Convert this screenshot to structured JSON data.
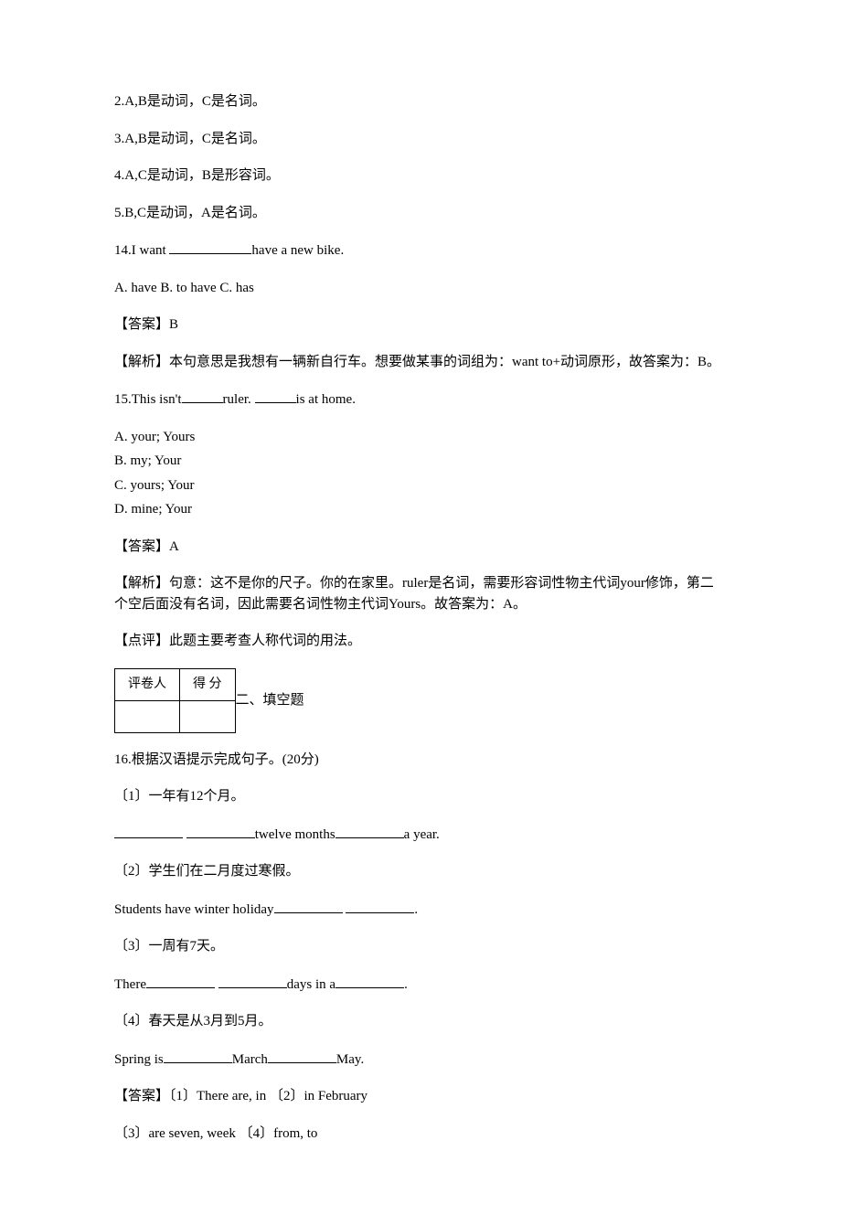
{
  "notes": {
    "n2": "2.A,B是动词，C是名词。",
    "n3": "3.A,B是动词，C是名词。",
    "n4": "4.A,C是动词，B是形容词。",
    "n5": "5.B,C是动词，A是名词。"
  },
  "q14": {
    "stem_pre": "14.I want ",
    "stem_post": "have a new bike.",
    "opts": "A. have   B. to have   C. has",
    "ans_label": "【答案】B",
    "explain": "【解析】本句意思是我想有一辆新自行车。想要做某事的词组为：want to+动词原形，故答案为：B。"
  },
  "q15": {
    "stem_pre": "15.This isn't",
    "stem_mid": "ruler. ",
    "stem_post": "is at home.",
    "optA": "A. your; Yours",
    "optB": "B. my; Your",
    "optC": "C. yours; Your",
    "optD": "D. mine; Your",
    "ans_label": "【答案】A",
    "explain": "【解析】句意：这不是你的尺子。你的在家里。ruler是名词，需要形容词性物主代词your修饰，第二个空后面没有名词，因此需要名词性物主代词Yours。故答案为：A。",
    "comment": "【点评】此题主要考查人称代词的用法。"
  },
  "section2": {
    "th1": "评卷人",
    "th2": "得   分",
    "title": "二、填空题"
  },
  "q16": {
    "title": "16.根据汉语提示完成句子。(20分)",
    "s1_cn": "〔1〕一年有12个月。",
    "s1_en_mid": "twelve  months",
    "s1_en_end": "a  year.",
    "s2_cn": "〔2〕学生们在二月度过寒假。",
    "s2_en_pre": "Students have  winter holiday",
    "s2_en_end": ".",
    "s3_cn": "〔3〕一周有7天。",
    "s3_en_pre": "There",
    "s3_en_mid": "days in a",
    "s3_en_end": ".",
    "s4_cn": "〔4〕春天是从3月到5月。",
    "s4_en_pre": "Spring is",
    "s4_en_mid": "March",
    "s4_en_end": "May.",
    "ans_line1": "【答案】〔1〕There are, in   〔2〕in February",
    "ans_line2": "〔3〕are seven, week  〔4〕from, to"
  }
}
